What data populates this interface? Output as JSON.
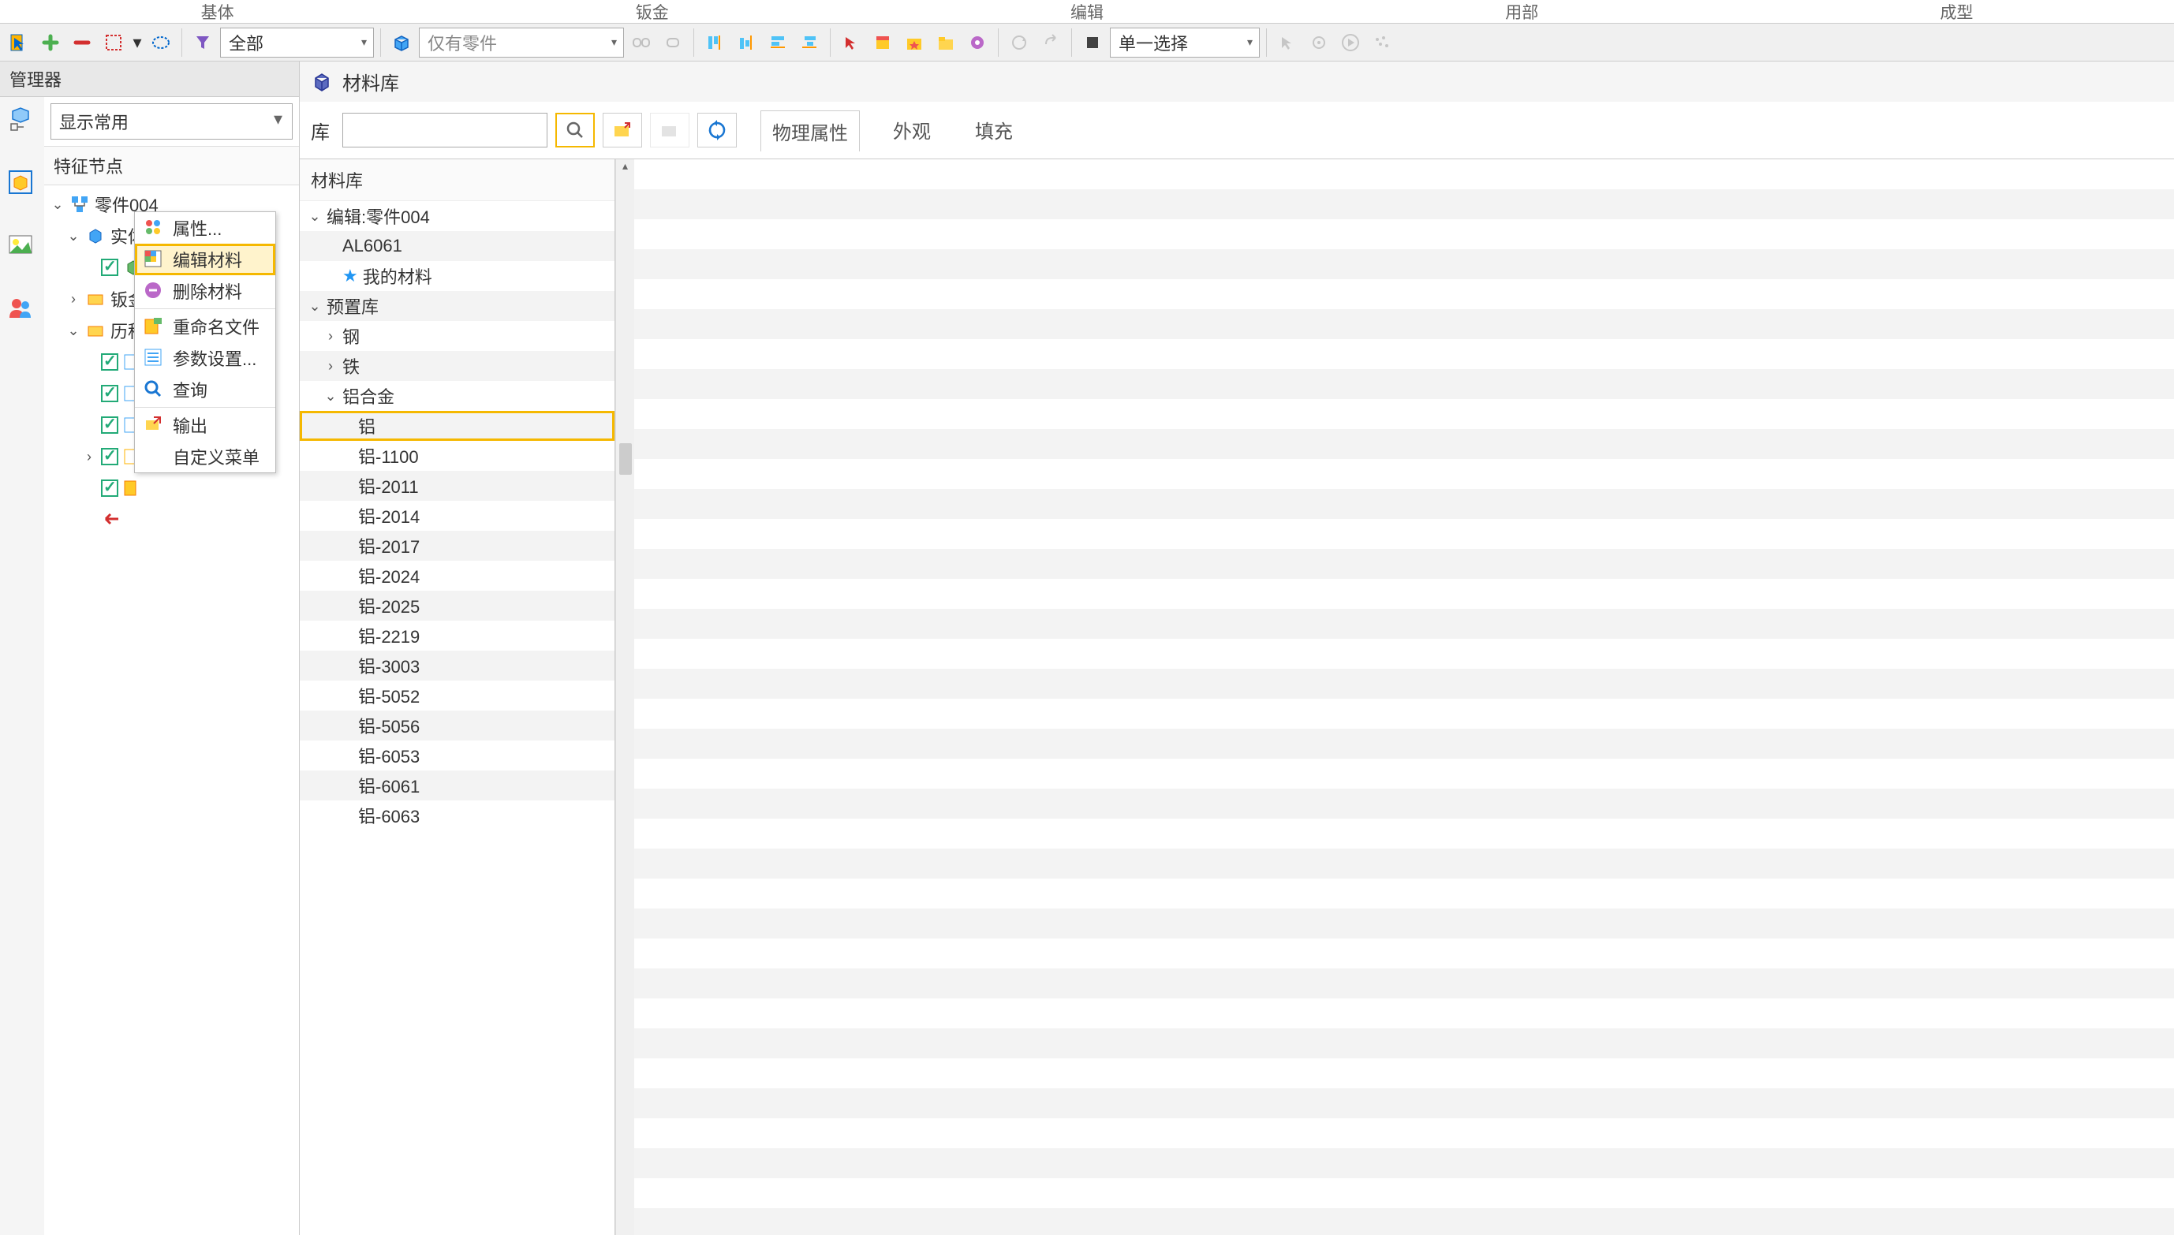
{
  "menubar": {
    "items": [
      "基体",
      "钣金",
      "编辑",
      "用部",
      "成型"
    ]
  },
  "toolbar": {
    "select1": "全部",
    "select2": "仅有零件",
    "select3": "单一选择"
  },
  "manager": {
    "title": "管理器",
    "display_combo": "显示常用",
    "feature_label": "特征节点",
    "tree": {
      "root": "零件004",
      "solid": "实体",
      "sheet": "钣金",
      "history": "历程"
    }
  },
  "context_menu": {
    "items": [
      {
        "label": "属性...",
        "highlighted": false
      },
      {
        "label": "编辑材料",
        "highlighted": true
      },
      {
        "label": "删除材料",
        "highlighted": false
      },
      {
        "label": "重命名文件",
        "highlighted": false
      },
      {
        "label": "参数设置...",
        "highlighted": false
      },
      {
        "label": "查询",
        "highlighted": false
      },
      {
        "label": "输出",
        "highlighted": false
      },
      {
        "label": "自定义菜单",
        "highlighted": false
      }
    ]
  },
  "material_panel": {
    "title": "材料库",
    "lib_label": "库",
    "search_placeholder": "",
    "tabs": {
      "physical": "物理属性",
      "appearance": "外观",
      "fill": "填充"
    },
    "tree_header": "材料库",
    "edit_node": "编辑:零件004",
    "al6061": "AL6061",
    "my_materials": "我的材料",
    "preset_lib": "预置库",
    "steel": "钢",
    "iron": "铁",
    "aluminum_alloy": "铝合金",
    "aluminum_items": [
      "铝",
      "铝-1100",
      "铝-2011",
      "铝-2014",
      "铝-2017",
      "铝-2024",
      "铝-2025",
      "铝-2219",
      "铝-3003",
      "铝-5052",
      "铝-5056",
      "铝-6053",
      "铝-6061",
      "铝-6063"
    ],
    "highlighted_item": "铝"
  }
}
